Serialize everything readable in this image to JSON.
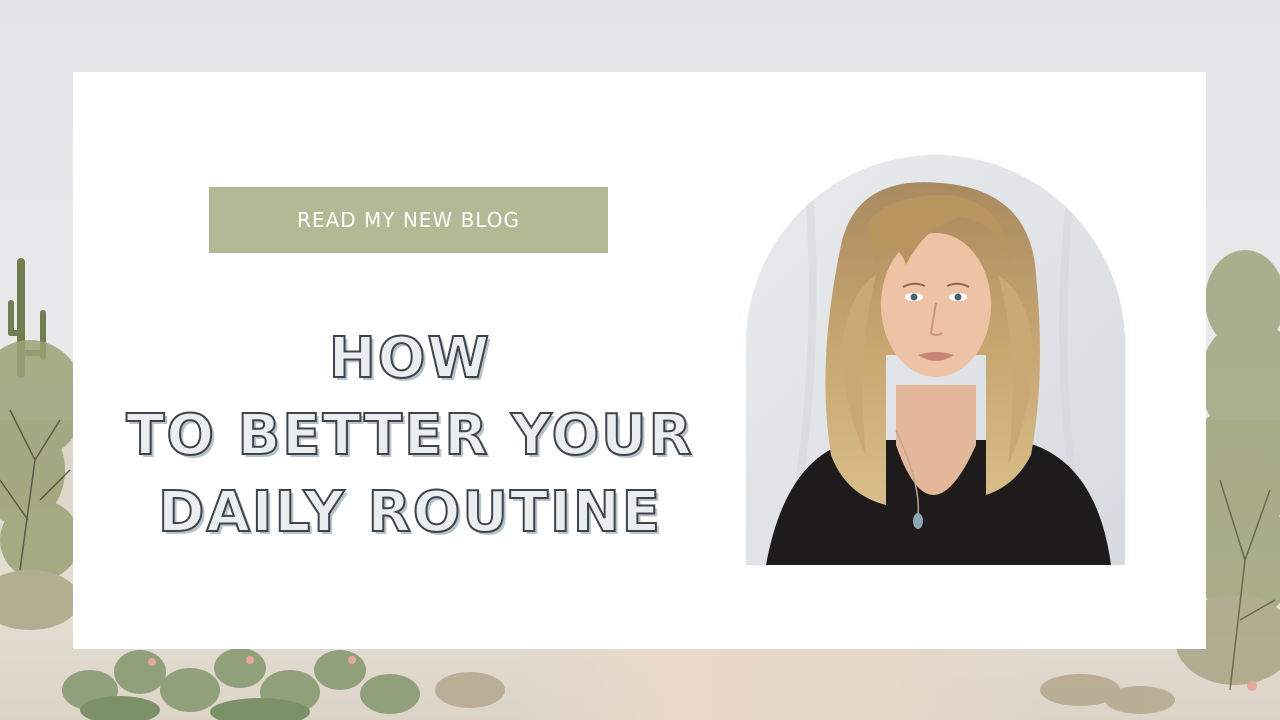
{
  "cta": {
    "label": "READ MY NEW BLOG"
  },
  "headline": {
    "line1": "HOW",
    "line2": "TO BETTER YOUR",
    "line3": "DAILY ROUTINE"
  },
  "portrait": {
    "subject": "woman-portrait"
  },
  "colors": {
    "cta_background": "#b3b994",
    "headline_fill": "#ebeef0",
    "headline_outline": "#3f444a",
    "headline_shadow": "#b8c4cc",
    "card_background": "#ffffff"
  }
}
